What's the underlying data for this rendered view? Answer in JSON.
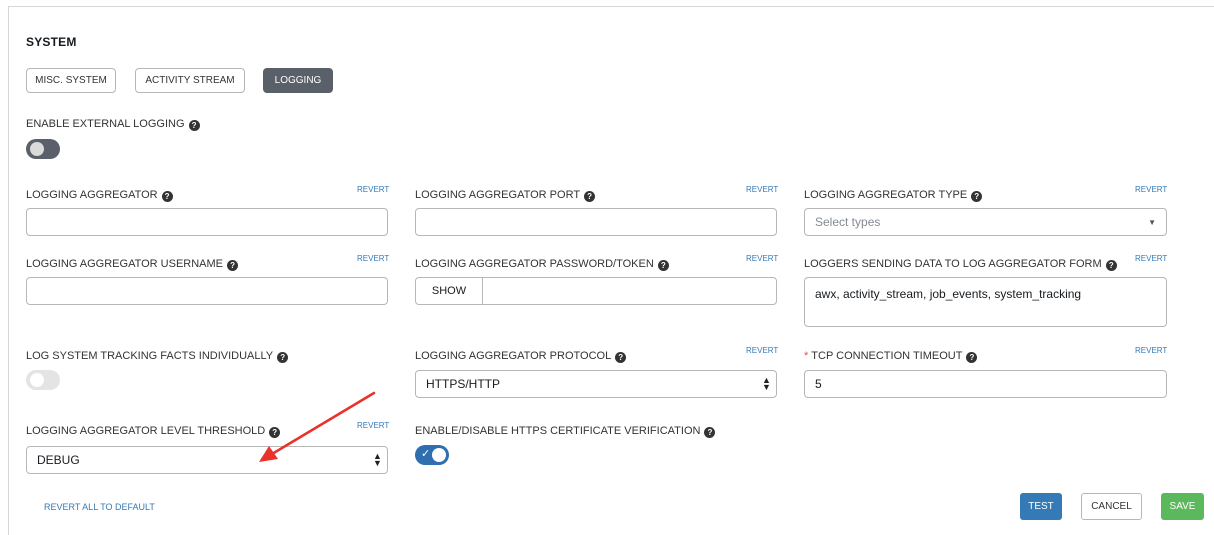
{
  "section_title": "SYSTEM",
  "tabs": [
    {
      "label": "MISC. SYSTEM",
      "active": false
    },
    {
      "label": "ACTIVITY STREAM",
      "active": false
    },
    {
      "label": "LOGGING",
      "active": true
    }
  ],
  "enable_external_logging": {
    "label": "ENABLE EXTERNAL LOGGING",
    "enabled": false
  },
  "revert_label": "REVERT",
  "fields": {
    "aggregator": {
      "label": "LOGGING AGGREGATOR",
      "value": ""
    },
    "port": {
      "label": "LOGGING AGGREGATOR PORT",
      "value": ""
    },
    "type": {
      "label": "LOGGING AGGREGATOR TYPE",
      "placeholder": "Select types"
    },
    "username": {
      "label": "LOGGING AGGREGATOR USERNAME",
      "value": ""
    },
    "password": {
      "label": "LOGGING AGGREGATOR PASSWORD/TOKEN",
      "show_label": "SHOW",
      "value": ""
    },
    "loggers": {
      "label": "LOGGERS SENDING DATA TO LOG AGGREGATOR FORM",
      "value": "awx, activity_stream, job_events, system_tracking"
    },
    "tracking_facts": {
      "label": "LOG SYSTEM TRACKING FACTS INDIVIDUALLY",
      "enabled": false
    },
    "protocol": {
      "label": "LOGGING AGGREGATOR PROTOCOL",
      "value": "HTTPS/HTTP"
    },
    "tcp_timeout": {
      "label": "TCP CONNECTION TIMEOUT",
      "required_mark": "*",
      "value": "5"
    },
    "level_threshold": {
      "label": "LOGGING AGGREGATOR LEVEL THRESHOLD",
      "value": "DEBUG"
    },
    "cert_verification": {
      "label": "ENABLE/DISABLE HTTPS CERTIFICATE VERIFICATION",
      "enabled": true
    }
  },
  "footer": {
    "revert_all": "REVERT ALL TO DEFAULT",
    "test": "TEST",
    "cancel": "CANCEL",
    "save": "SAVE"
  },
  "colors": {
    "primary": "#337ab7",
    "success": "#5cb85c",
    "toggle_on": "#2f6fb0",
    "toggle_off": "#5a6069",
    "required": "#d9534f",
    "annotation_arrow": "#e8322a"
  },
  "icons": {
    "help": "question-circle-icon",
    "select_caret": "caret-down-icon",
    "select_updown": "sort-updown-icon",
    "check": "check-icon",
    "arrow": "annotation-arrow"
  }
}
